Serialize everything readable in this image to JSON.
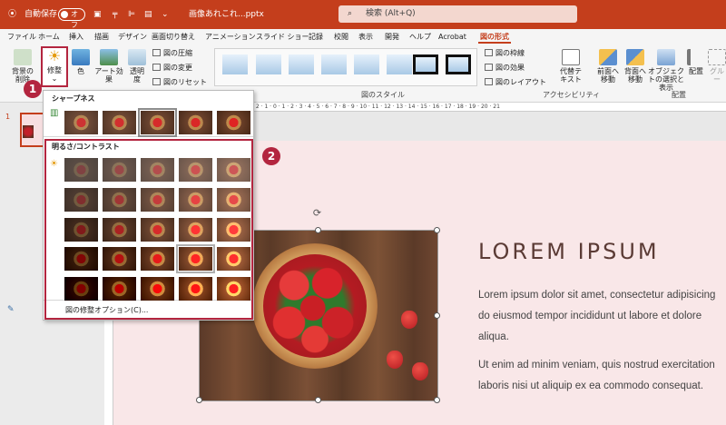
{
  "titlebar": {
    "autosave_label": "自動保存",
    "autosave_state": "オフ",
    "filename": "画像あれこれ...pptx",
    "search_placeholder": "検索 (Alt+Q)"
  },
  "menu_tabs": [
    "ファイル",
    "ホーム",
    "挿入",
    "描画",
    "デザイン",
    "画面切り替え",
    "アニメーション",
    "スライド ショー",
    "記録",
    "校閲",
    "表示",
    "開発",
    "ヘルプ",
    "Acrobat",
    "図の形式"
  ],
  "ribbon": {
    "remove_bg": "背景の削除",
    "corrections": "修整",
    "color": "色",
    "artistic_effects": "アート効果",
    "transparency": "透明度",
    "compress": "図の圧縮",
    "change": "図の変更",
    "reset": "図のリセット",
    "style_group": "図のスタイル",
    "border": "図の枠線",
    "effects": "図の効果",
    "layout": "図のレイアウト",
    "alt_text": "代替テキスト",
    "accessibility": "アクセシビリティ",
    "bring_forward": "前面へ移動",
    "send_backward": "背面へ移動",
    "selection_pane": "オブジェクトの選択と表示",
    "align": "配置",
    "group": "グルー",
    "arrange_group": "配置"
  },
  "thumbnail_panel": {
    "slide_number": "1"
  },
  "dropdown": {
    "sharpness_header": "シャープネス",
    "brightness_header": "明るさ/コントラスト",
    "options_link": "図の修整オプション(C)..."
  },
  "badges": {
    "one": "1",
    "two": "2"
  },
  "slide": {
    "title": "LOREM IPSUM",
    "body": [
      "Lorem ipsum dolor sit amet, consectetur adipisicing",
      "do eiusmod tempor incididunt ut labore et dolore",
      "aliqua.",
      "Ut enim ad minim veniam, quis nostrud exercitation",
      "laboris nisi ut aliquip ex ea commodo consequat."
    ]
  },
  "colors": {
    "accent": "#c43e1c",
    "highlight": "#b3253f",
    "slide_bg": "#f9e7e8"
  }
}
